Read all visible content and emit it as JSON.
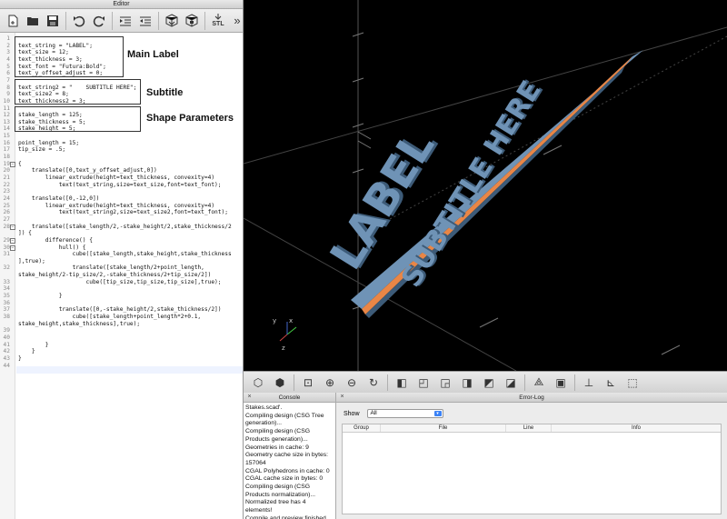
{
  "editor": {
    "title": "Editor",
    "toolbar": {
      "icons": [
        "new-file-icon",
        "open-file-icon",
        "save-icon",
        "undo-icon",
        "redo-icon",
        "indent-icon",
        "unindent-icon",
        "preview-icon",
        "render-icon",
        "export-stl-icon",
        "more-icon"
      ],
      "stl_label": "STL",
      "more_label": "»"
    },
    "lines": [
      {
        "n": "1",
        "text": ""
      },
      {
        "n": "2",
        "text": "text_string = \"LABEL\";"
      },
      {
        "n": "3",
        "text": "text_size = 12;"
      },
      {
        "n": "4",
        "text": "text_thickness = 3;"
      },
      {
        "n": "5",
        "text": "text_font = \"Futura:Bold\";"
      },
      {
        "n": "6",
        "text": "text_y_offset_adjust = 0;"
      },
      {
        "n": "7",
        "text": ""
      },
      {
        "n": "8",
        "text": "text_string2 = \"    SUBTITLE HERE\";"
      },
      {
        "n": "9",
        "text": "text_size2 = 8;"
      },
      {
        "n": "10",
        "text": "text_thickness2 = 3;"
      },
      {
        "n": "11",
        "text": ""
      },
      {
        "n": "12",
        "text": "stake_length = 125;"
      },
      {
        "n": "13",
        "text": "stake_thickness = 5;"
      },
      {
        "n": "14",
        "text": "stake_height = 5;"
      },
      {
        "n": "15",
        "text": ""
      },
      {
        "n": "16",
        "text": "point_length = 15;"
      },
      {
        "n": "17",
        "text": "tip_size = .5;"
      },
      {
        "n": "18",
        "text": ""
      },
      {
        "n": "19",
        "text": "{"
      },
      {
        "n": "20",
        "text": "    translate([0,text_y_offset_adjust,0])"
      },
      {
        "n": "21",
        "text": "        linear_extrude(height=text_thickness, convexity=4)"
      },
      {
        "n": "22",
        "text": "            text(text_string,size=text_size,font=text_font);"
      },
      {
        "n": "23",
        "text": ""
      },
      {
        "n": "24",
        "text": "    translate([0,-12,0])"
      },
      {
        "n": "25",
        "text": "        linear_extrude(height=text_thickness, convexity=4)"
      },
      {
        "n": "26",
        "text": "            text(text_string2,size=text_size2,font=text_font);"
      },
      {
        "n": "27",
        "text": ""
      },
      {
        "n": "28",
        "text": "    translate([stake_length/2,-stake_height/2,stake_thickness/2"
      },
      {
        "n": "",
        "text": "]) {"
      },
      {
        "n": "29",
        "text": "        difference() {"
      },
      {
        "n": "30",
        "text": "            hull() {"
      },
      {
        "n": "31",
        "text": "                cube([stake_length,stake_height,stake_thickness"
      },
      {
        "n": "",
        "text": "],true);"
      },
      {
        "n": "32",
        "text": "                translate([stake_length/2+point_length,"
      },
      {
        "n": "",
        "text": "stake_height/2-tip_size/2,-stake_thickness/2+tip_size/2])"
      },
      {
        "n": "33",
        "text": "                    cube([tip_size,tip_size,tip_size],true);"
      },
      {
        "n": "34",
        "text": ""
      },
      {
        "n": "35",
        "text": "            }"
      },
      {
        "n": "36",
        "text": ""
      },
      {
        "n": "37",
        "text": "            translate([0,-stake_height/2,stake_thickness/2])"
      },
      {
        "n": "38",
        "text": "                cube([stake_length+point_length*2+0.1,"
      },
      {
        "n": "",
        "text": "stake_height,stake_thickness],true);"
      },
      {
        "n": "39",
        "text": ""
      },
      {
        "n": "40",
        "text": ""
      },
      {
        "n": "41",
        "text": "        }"
      },
      {
        "n": "42",
        "text": "    }"
      },
      {
        "n": "43",
        "text": "}"
      },
      {
        "n": "44",
        "text": ""
      }
    ],
    "annotations": {
      "main_label": "Main Label",
      "subtitle": "Subtitle",
      "shape_parameters": "Shape Parameters"
    }
  },
  "viewport": {
    "model_text_main": "LABEL",
    "model_text_sub": "SUBTITLE HERE",
    "colors": {
      "background": "#000000",
      "model": "#6f93b6",
      "model_shadow": "#3d5b78",
      "stake_face": "#e98646"
    },
    "axes_labels": {
      "x": "x",
      "y": "y",
      "z": "z"
    }
  },
  "view_toolbar": {
    "icons": [
      "preview-icon",
      "render-icon",
      "zoom-all-icon",
      "zoom-in-icon",
      "zoom-out-icon",
      "reset-view-icon",
      "view-right-icon",
      "view-top-icon",
      "view-bottom-icon",
      "view-left-icon",
      "view-front-icon",
      "view-back-icon",
      "perspective-icon",
      "orthogonal-icon",
      "show-axes-icon",
      "show-scale-icon",
      "show-edges-icon"
    ]
  },
  "console": {
    "title": "Console",
    "close": "×",
    "lines": [
      "Stakes.scad'.",
      "Compiling design (CSG Tree generation)...",
      "Compiling design (CSG Products generation)...",
      "Geometries in cache: 9",
      "Geometry cache size in bytes: 157064",
      "CGAL Polyhedrons in cache: 0",
      "CGAL cache size in bytes: 0",
      "Compiling design (CSG Products normalization)...",
      "Normalized tree has 4 elements!",
      "Compile and preview finished."
    ]
  },
  "error_log": {
    "title": "Error-Log",
    "close": "×",
    "show_label": "Show",
    "show_value": "All",
    "columns": [
      "Group",
      "File",
      "Line",
      "Info"
    ]
  }
}
